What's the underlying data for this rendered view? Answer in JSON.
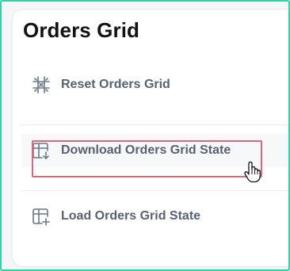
{
  "panel": {
    "title": "Orders Grid",
    "items": [
      {
        "label": "Reset Orders Grid",
        "icon": "grid-reset-icon"
      },
      {
        "label": "Download Orders Grid State",
        "icon": "grid-download-icon"
      },
      {
        "label": "Load Orders Grid State",
        "icon": "grid-add-icon"
      }
    ],
    "highlighted_item": "Download Orders Grid State"
  },
  "colors": {
    "frame_border": "#2ed3a6",
    "title": "#111318",
    "item_text": "#566272",
    "icon": "#6b7787",
    "highlight_border": "#d56b7a"
  },
  "cursor": {
    "icon": "hand-pointer-icon"
  }
}
